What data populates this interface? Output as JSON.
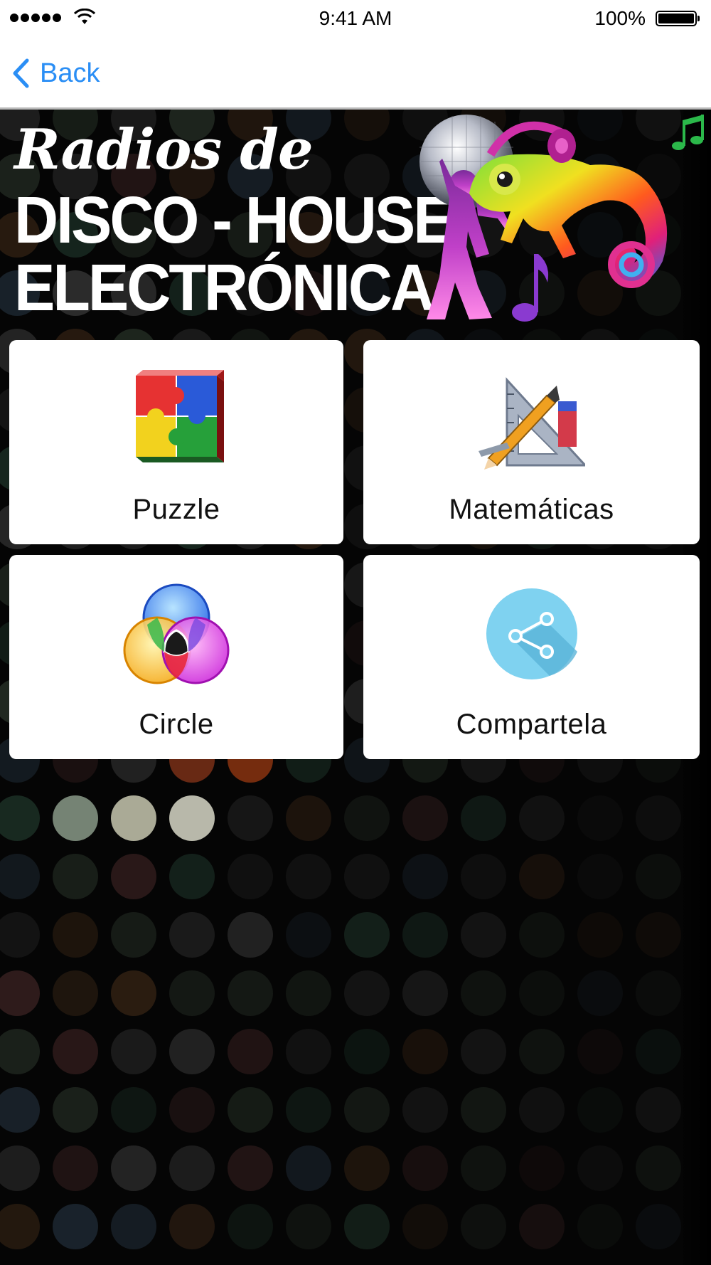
{
  "status_bar": {
    "time": "9:41 AM",
    "battery_percent": "100%",
    "signal_bars": 5,
    "icons": [
      "signal-dots-icon",
      "wifi-icon",
      "battery-icon"
    ]
  },
  "nav": {
    "back_label": "Back",
    "back_icon": "chevron-left-icon",
    "accent_color": "#2a8ef5"
  },
  "banner": {
    "line1": "Radios de",
    "line2": "DISCO - HOUSE",
    "line3": "ELECTRÓNICA"
  },
  "tiles": [
    {
      "label": "Puzzle",
      "icon": "puzzle-icon"
    },
    {
      "label": "Matemáticas",
      "icon": "math-tools-icon"
    },
    {
      "label": "Circle",
      "icon": "color-circles-icon"
    },
    {
      "label": "Compartela",
      "icon": "share-icon"
    }
  ]
}
